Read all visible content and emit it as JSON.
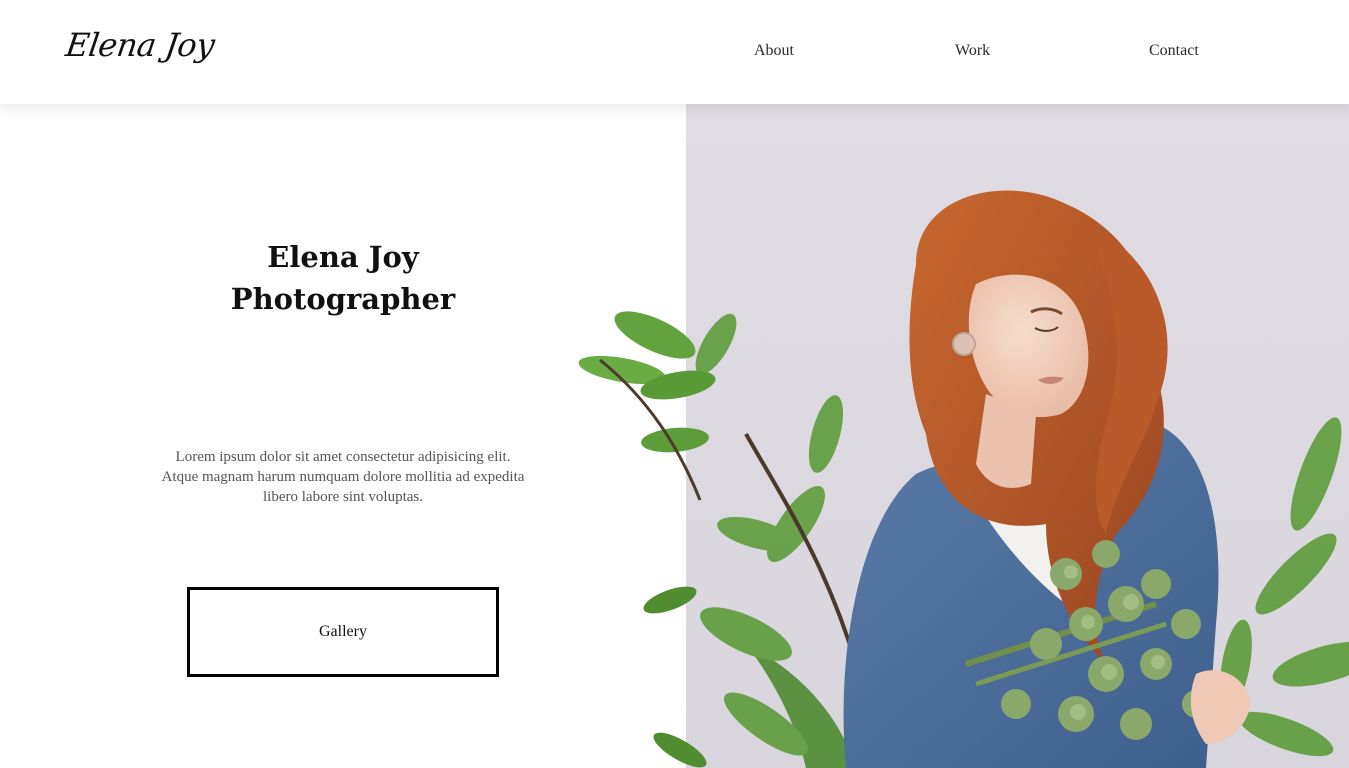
{
  "header": {
    "logo": "Elena Joy",
    "nav": {
      "about": "About",
      "work": "Work",
      "contact": "Contact"
    }
  },
  "hero": {
    "title_line1": "Elena Joy",
    "title_line2": "Photographer",
    "description": "Lorem ipsum dolor sit amet consectetur adipisicing elit. Atque magnam harum numquam dolore mollitia ad expedita libero labore sint voluptas.",
    "button_label": "Gallery"
  },
  "colors": {
    "photo_background": "#dedce2",
    "leaf_green": "#5e9a3a",
    "sweater_blue": "#4f6f9e",
    "hair": "#b4562a"
  },
  "icons": {
    "portrait": "woman-with-flowers-photo"
  }
}
